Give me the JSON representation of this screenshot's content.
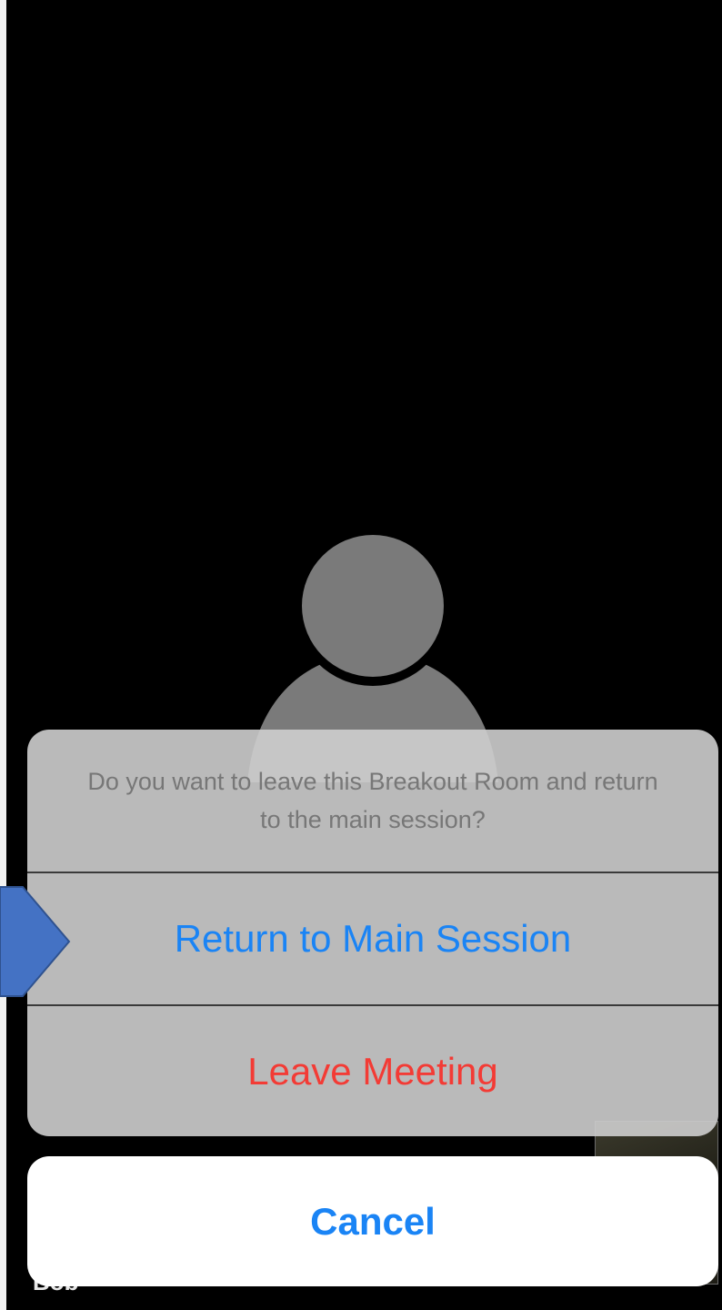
{
  "video": {
    "participant_name": "Bob"
  },
  "action_sheet": {
    "message": "Do you want to leave this Breakout Room and return to the main session?",
    "return_label": "Return to Main Session",
    "leave_label": "Leave Meeting",
    "cancel_label": "Cancel"
  },
  "colors": {
    "accent_blue": "#1a84f5",
    "destructive_red": "#f33b35",
    "pointer_arrow": "#4472c4"
  },
  "icons": {
    "avatar": "default-avatar-icon",
    "pointer": "arrow-right-icon"
  }
}
